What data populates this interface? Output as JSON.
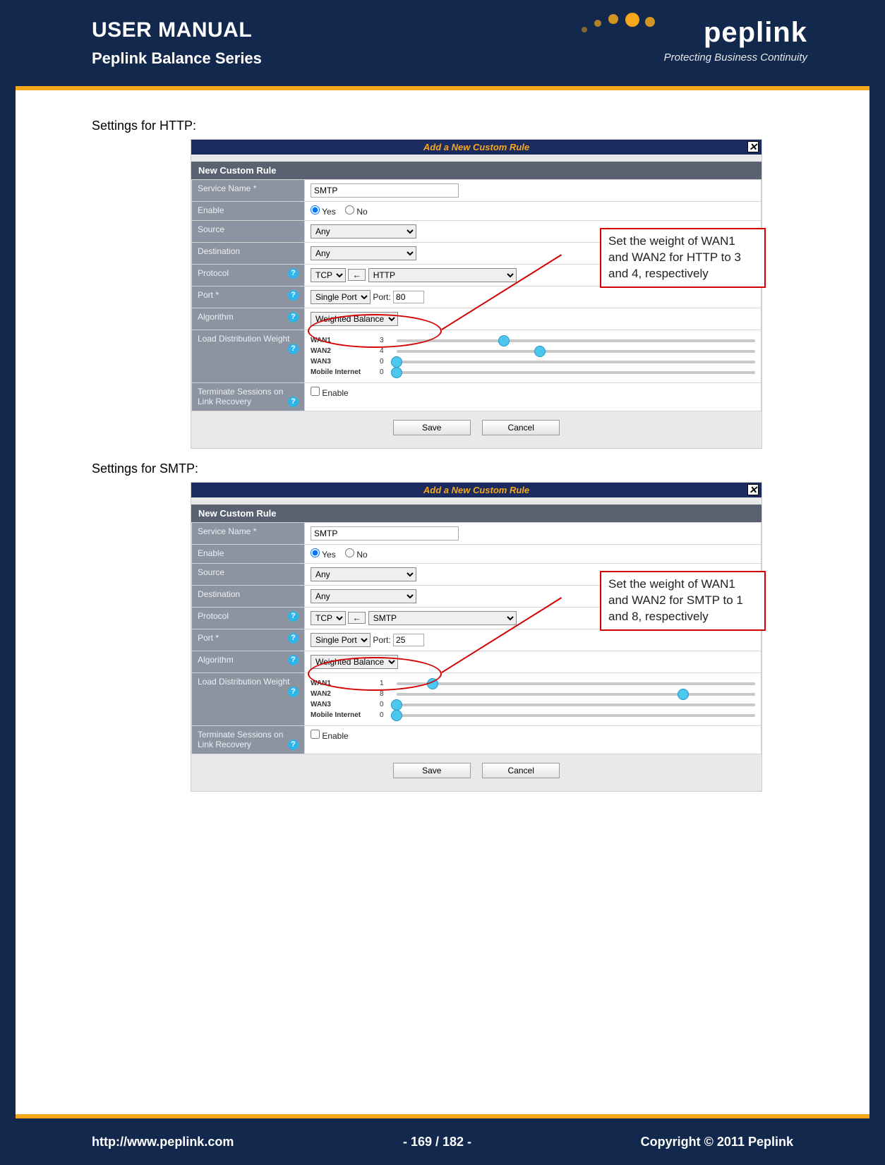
{
  "header": {
    "title": "USER MANUAL",
    "subtitle": "Peplink Balance Series",
    "brand": "peplink",
    "tagline": "Protecting Business Continuity"
  },
  "footer": {
    "url": "http://www.peplink.com",
    "page": "- 169 / 182 -",
    "copyright": "Copyright © 2011 Peplink"
  },
  "sections": [
    {
      "label": "Settings for HTTP:",
      "callout": "Set the weight of WAN1 and WAN2 for HTTP to 3 and 4, respectively",
      "panel": {
        "title": "Add a New Custom Rule",
        "subhead": "New Custom Rule",
        "fields": {
          "service_name_label": "Service Name *",
          "service_name_value": "SMTP",
          "enable_label": "Enable",
          "enable_yes": "Yes",
          "enable_no": "No",
          "source_label": "Source",
          "source_value": "Any",
          "destination_label": "Destination",
          "destination_value": "Any",
          "protocol_label": "Protocol",
          "protocol_select": "TCP",
          "protocol_helper": "HTTP",
          "port_label": "Port *",
          "port_mode": "Single Port",
          "port_prefix": "Port:",
          "port_value": "80",
          "algorithm_label": "Algorithm",
          "algorithm_value": "Weighted Balance",
          "load_label": "Load Distribution Weight",
          "wans": [
            {
              "name": "WAN1",
              "value": 3,
              "pct": 30
            },
            {
              "name": "WAN2",
              "value": 4,
              "pct": 40
            },
            {
              "name": "WAN3",
              "value": 0,
              "pct": 0
            },
            {
              "name": "Mobile Internet",
              "value": 0,
              "pct": 0
            }
          ],
          "terminate_label": "Terminate Sessions on Link Recovery",
          "terminate_option": "Enable",
          "save": "Save",
          "cancel": "Cancel"
        }
      }
    },
    {
      "label": "Settings for SMTP:",
      "callout": "Set the weight of WAN1 and WAN2 for SMTP to 1 and 8, respectively",
      "panel": {
        "title": "Add a New Custom Rule",
        "subhead": "New Custom Rule",
        "fields": {
          "service_name_label": "Service Name *",
          "service_name_value": "SMTP",
          "enable_label": "Enable",
          "enable_yes": "Yes",
          "enable_no": "No",
          "source_label": "Source",
          "source_value": "Any",
          "destination_label": "Destination",
          "destination_value": "Any",
          "protocol_label": "Protocol",
          "protocol_select": "TCP",
          "protocol_helper": "SMTP",
          "port_label": "Port *",
          "port_mode": "Single Port",
          "port_prefix": "Port:",
          "port_value": "25",
          "algorithm_label": "Algorithm",
          "algorithm_value": "Weighted Balance",
          "load_label": "Load Distribution Weight",
          "wans": [
            {
              "name": "WAN1",
              "value": 1,
              "pct": 10
            },
            {
              "name": "WAN2",
              "value": 8,
              "pct": 80
            },
            {
              "name": "WAN3",
              "value": 0,
              "pct": 0
            },
            {
              "name": "Mobile Internet",
              "value": 0,
              "pct": 0
            }
          ],
          "terminate_label": "Terminate Sessions on Link Recovery",
          "terminate_option": "Enable",
          "save": "Save",
          "cancel": "Cancel"
        }
      }
    }
  ]
}
